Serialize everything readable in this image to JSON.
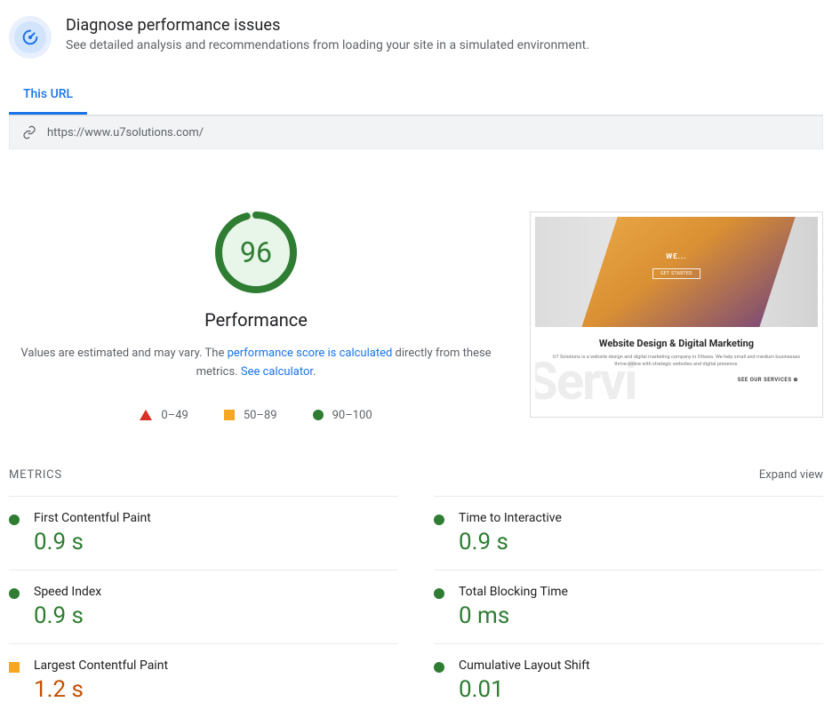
{
  "header": {
    "title": "Diagnose performance issues",
    "subtitle": "See detailed analysis and recommendations from loading your site in a simulated environment."
  },
  "tabs": {
    "this_url": "This URL"
  },
  "url": "https://www.u7solutions.com/",
  "score": {
    "value": "96",
    "label": "Performance",
    "desc_prefix": "Values are estimated and may vary. The ",
    "desc_link1": "performance score is calculated",
    "desc_mid": " directly from these metrics. ",
    "desc_link2": "See calculator",
    "desc_suffix": "."
  },
  "legend": {
    "low": "0–49",
    "mid": "50–89",
    "high": "90–100"
  },
  "preview": {
    "hero_text": "WE...",
    "hero_button": "GET STARTED",
    "headline": "Website Design & Digital Marketing",
    "body": "U7 Solutions is a website design and digital marketing company in Ottawa. We help small and medium businesses thrive online with strategic websites and digital presence.",
    "cta": "SEE OUR SERVICES ⊕",
    "decor": "Servi"
  },
  "metrics_section": {
    "title": "METRICS",
    "expand": "Expand view"
  },
  "metrics": [
    {
      "label": "First Contentful Paint",
      "value": "0.9 s",
      "status": "good"
    },
    {
      "label": "Time to Interactive",
      "value": "0.9 s",
      "status": "good"
    },
    {
      "label": "Speed Index",
      "value": "0.9 s",
      "status": "good"
    },
    {
      "label": "Total Blocking Time",
      "value": "0 ms",
      "status": "good"
    },
    {
      "label": "Largest Contentful Paint",
      "value": "1.2 s",
      "status": "warn"
    },
    {
      "label": "Cumulative Layout Shift",
      "value": "0.01",
      "status": "good"
    }
  ]
}
